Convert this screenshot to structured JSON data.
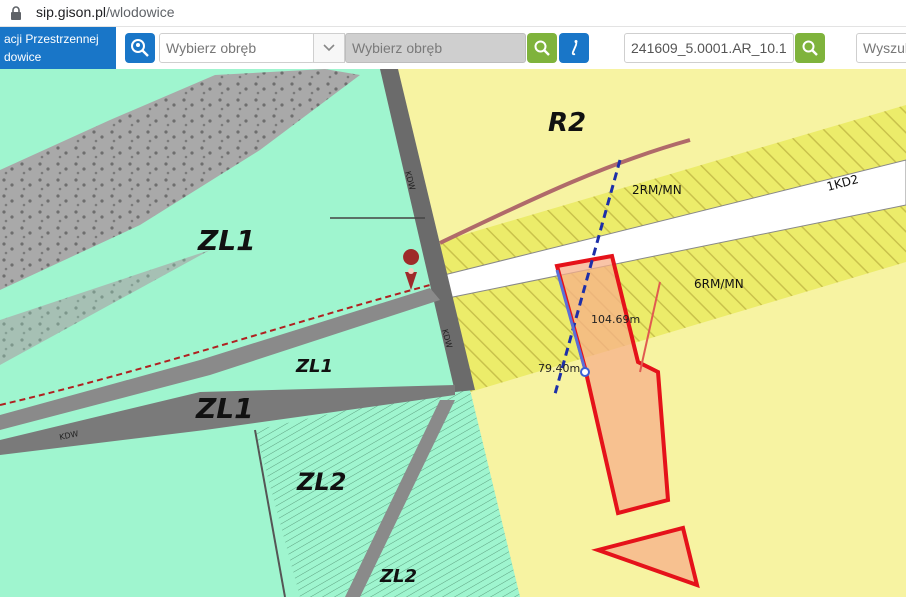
{
  "browser": {
    "domain": "sip.gison.pl",
    "path": "/wlodowice"
  },
  "header": {
    "title_line1": "acji Przestrzennej",
    "title_line2": "dowice"
  },
  "toolbar": {
    "obreb_select_placeholder": "Wybierz obręb",
    "obreb_input_placeholder": "Wybierz obręb",
    "parcel_id_value": "241609_5.0001.AR_10.1",
    "search_placeholder": "Wyszuk"
  },
  "map": {
    "zones": {
      "zl1_main": "ZL1",
      "zl1_small": "ZL1",
      "zl1_lower": "ZL1",
      "zl2_a": "ZL2",
      "zl2_b": "ZL2",
      "r2": "R2",
      "rm_mn_2": "2RM/MN",
      "kd_1": "1KD2",
      "rm_mn_6": "6RM/MN",
      "road_kdw_1": "KDW",
      "road_kdw_2": "KDW",
      "road_kdw_3": "KDW"
    },
    "measure_1": "104.69m",
    "measure_2": "79.40m"
  },
  "colors": {
    "forest": "#9ff5cf",
    "agri": "#f7f3a2",
    "residential": "#ecec6a",
    "parcel_fill": "#f7b089",
    "parcel_stroke": "#e5121a",
    "accent_blue": "#1976c8",
    "accent_green": "#7fb33c"
  }
}
